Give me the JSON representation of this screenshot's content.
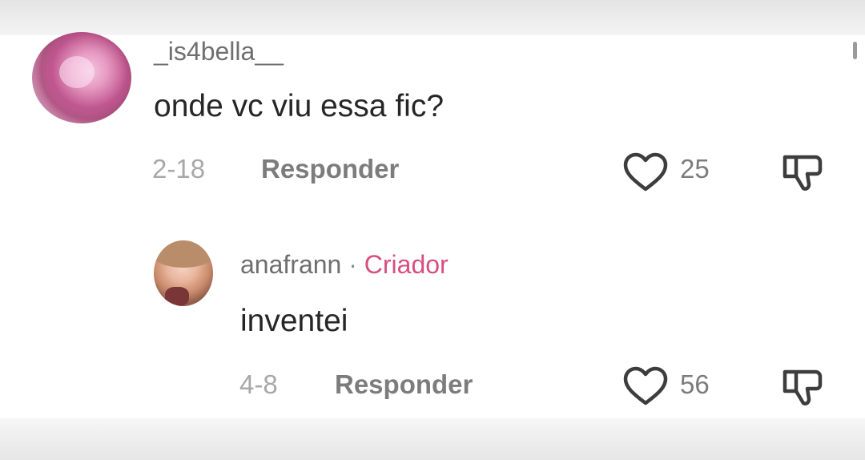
{
  "comments": [
    {
      "username": "_is4bella__",
      "text": "onde vc viu essa fic?",
      "date": "2-18",
      "reply_label": "Responder",
      "like_count": "25",
      "avatar": "pink-sparkle-avatar"
    },
    {
      "username": "anafrann",
      "separator": "·",
      "badge": "Criador",
      "text": "inventei",
      "date": "4-8",
      "reply_label": "Responder",
      "like_count": "56",
      "avatar": "person-photo-avatar"
    }
  ],
  "icons": {
    "like": "heart-outline-icon",
    "dislike": "thumbs-down-outline-icon"
  },
  "colors": {
    "creator_badge": "#d74f7f",
    "username": "#6f6f6f",
    "text": "#262626",
    "meta": "#a8a8a8"
  }
}
